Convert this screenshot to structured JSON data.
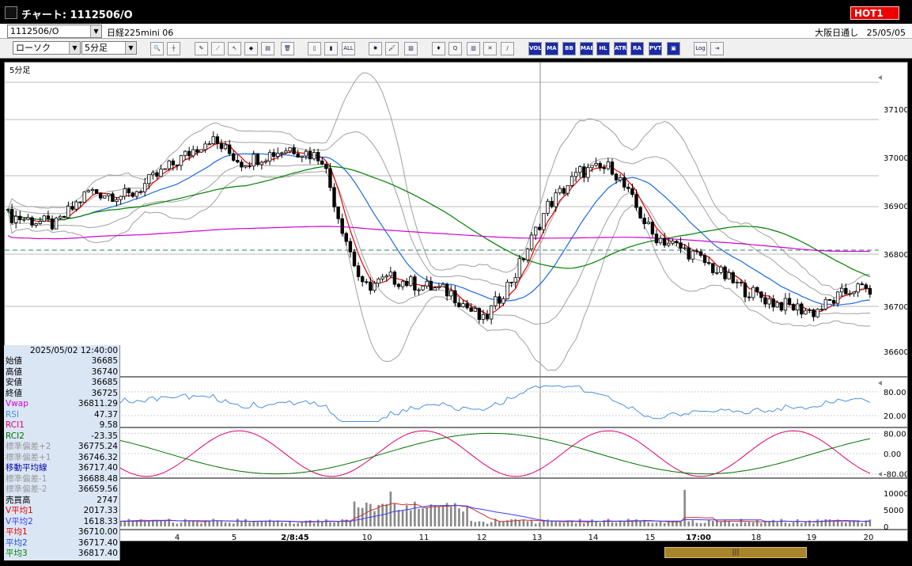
{
  "window": {
    "title": "チャート: 1112506/O",
    "hot_badge": "HOT1"
  },
  "infobar": {
    "symbol": "1112506/O",
    "instrument": "日経225mini 06",
    "market": "大阪日通し",
    "date": "25/05/05"
  },
  "toolbar": {
    "chart_type": "ローソク",
    "period": "5分足",
    "tools": [
      {
        "id": "zoom",
        "label": "🔍",
        "icon": "magnifier-icon"
      },
      {
        "id": "cursor-line",
        "label": "┼",
        "icon": "crosshair-icon"
      },
      {
        "id": "pen",
        "label": "✎",
        "icon": "pen-icon"
      },
      {
        "id": "trend",
        "label": "⟋",
        "icon": "trendline-icon"
      },
      {
        "id": "arrow",
        "label": "↖",
        "icon": "arrow-icon"
      },
      {
        "id": "fill",
        "label": "◆",
        "icon": "fill-icon"
      },
      {
        "id": "note",
        "label": "▤",
        "icon": "note-icon"
      },
      {
        "id": "trash",
        "label": "🗑",
        "icon": "trash-icon"
      },
      {
        "id": "candle1",
        "label": "▯",
        "icon": "candle-icon"
      },
      {
        "id": "candle2",
        "label": "▮",
        "icon": "candle-icon"
      },
      {
        "id": "all",
        "label": "ALL",
        "icon": "all-icon"
      },
      {
        "id": "gear",
        "label": "✹",
        "icon": "settings-icon"
      },
      {
        "id": "brush",
        "label": "🖌",
        "icon": "brush-icon"
      },
      {
        "id": "color",
        "label": "▨",
        "icon": "color-icon"
      },
      {
        "id": "mark",
        "label": "♦",
        "icon": "marker-icon"
      },
      {
        "id": "search",
        "label": "Q",
        "icon": "search-icon"
      },
      {
        "id": "bars",
        "label": "▥",
        "icon": "bars-icon"
      },
      {
        "id": "cross",
        "label": "✕",
        "icon": "cross-icon"
      },
      {
        "id": "disabled",
        "label": "/",
        "icon": "disabled-icon"
      },
      {
        "id": "vol",
        "label": "VOL",
        "icon": "volume-icon"
      },
      {
        "id": "ma",
        "label": "MA",
        "icon": "ma-icon"
      },
      {
        "id": "bb",
        "label": "BB",
        "icon": "bollinger-icon"
      },
      {
        "id": "mae",
        "label": "MAE",
        "icon": "envelope-icon"
      },
      {
        "id": "hl",
        "label": "HL",
        "icon": "hl-icon"
      },
      {
        "id": "atr",
        "label": "ATR",
        "icon": "atr-icon"
      },
      {
        "id": "kagi",
        "label": "RA",
        "icon": "ra-icon"
      },
      {
        "id": "pvt",
        "label": "PVT",
        "icon": "pvt-icon"
      },
      {
        "id": "box",
        "label": "▣",
        "icon": "box-icon"
      },
      {
        "id": "log",
        "label": "Log",
        "icon": "log-icon"
      },
      {
        "id": "exit",
        "label": "⇥",
        "icon": "exit-icon"
      }
    ]
  },
  "chart": {
    "period_label": "5分足",
    "price_ticks": [
      "37100",
      "37000",
      "36900",
      "36800",
      "36700",
      "36600"
    ],
    "osc1_ticks": [
      "80.00",
      "20.00"
    ],
    "osc2_ticks": [
      "80.00",
      "0.00",
      "-80.00"
    ],
    "vol_ticks": [
      "10000",
      "5000",
      "0"
    ],
    "date_labels": [
      "4",
      "5",
      "2/8:45",
      "10",
      "11",
      "12",
      "13",
      "14",
      "15",
      "17:00",
      "18",
      "19",
      "20"
    ]
  },
  "datapanel": {
    "datetime": "2025/05/02 12:40:00",
    "rows": [
      {
        "label": "始値",
        "value": "36685",
        "color": "#000000"
      },
      {
        "label": "高値",
        "value": "36740",
        "color": "#000000"
      },
      {
        "label": "安値",
        "value": "36685",
        "color": "#000000"
      },
      {
        "label": "終値",
        "value": "36725",
        "color": "#000000"
      },
      {
        "label": "Vwap",
        "value": "36811.29",
        "color": "#d000d0"
      },
      {
        "label": "RSI",
        "value": "47.37",
        "color": "#4a90e2"
      },
      {
        "label": "RCI1",
        "value": "9.58",
        "color": "#e0006e"
      },
      {
        "label": "RCI2",
        "value": "-23.35",
        "color": "#007000"
      },
      {
        "label": "標準偏差+2",
        "value": "36775.24",
        "color": "#999999"
      },
      {
        "label": "標準偏差+1",
        "value": "36746.32",
        "color": "#999999"
      },
      {
        "label": "移動平均線",
        "value": "36717.40",
        "color": "#0000a0"
      },
      {
        "label": "標準偏差-1",
        "value": "36688.48",
        "color": "#999999"
      },
      {
        "label": "標準偏差-2",
        "value": "36659.56",
        "color": "#999999"
      },
      {
        "label": "売買高",
        "value": "2747",
        "color": "#000000"
      },
      {
        "label": "V平均1",
        "value": "2017.33",
        "color": "#e00000"
      },
      {
        "label": "V平均2",
        "value": "1618.33",
        "color": "#3a3aff"
      },
      {
        "label": "平均1",
        "value": "36710.00",
        "color": "#e00000"
      },
      {
        "label": "平均2",
        "value": "36717.40",
        "color": "#1a50d0"
      },
      {
        "label": "平均3",
        "value": "36817.40",
        "color": "#008000"
      }
    ]
  },
  "colors": {
    "up_candle": "#ffffff",
    "down_candle": "#000000",
    "ma1": "#e00000",
    "ma2": "#1a6ae0",
    "ma3": "#008000",
    "vwap": "#d000d0",
    "bands": "#a0a0a0",
    "rsi": "#4a90e2",
    "rci1": "#e0006e",
    "rci2": "#007000"
  }
}
